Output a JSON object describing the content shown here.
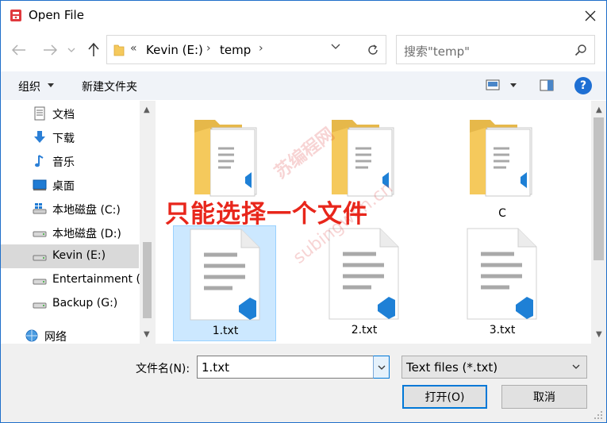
{
  "window": {
    "title": "Open File"
  },
  "address": {
    "overflow": "«",
    "segments": [
      "Kevin (E:)",
      "temp"
    ]
  },
  "search": {
    "placeholder": "搜索\"temp\""
  },
  "toolbar": {
    "organize_label": "组织",
    "new_folder_label": "新建文件夹",
    "help_label": "?"
  },
  "sidebar": {
    "items": [
      {
        "label": "文档",
        "icon": "documents-icon"
      },
      {
        "label": "下载",
        "icon": "downloads-icon"
      },
      {
        "label": "音乐",
        "icon": "music-icon"
      },
      {
        "label": "桌面",
        "icon": "desktop-icon"
      },
      {
        "label": "本地磁盘 (C:)",
        "icon": "windows-drive-icon"
      },
      {
        "label": "本地磁盘 (D:)",
        "icon": "drive-icon"
      },
      {
        "label": "Kevin (E:)",
        "icon": "drive-icon",
        "selected": true
      },
      {
        "label": "Entertainment (",
        "icon": "drive-icon"
      },
      {
        "label": "Backup (G:)",
        "icon": "drive-icon"
      },
      {
        "label": "网络",
        "icon": "network-icon"
      }
    ]
  },
  "files": [
    {
      "label": "",
      "kind": "folder"
    },
    {
      "label": "",
      "kind": "folder"
    },
    {
      "label": "C",
      "kind": "folder"
    },
    {
      "label": "1.txt",
      "kind": "text-file",
      "selected": true
    },
    {
      "label": "2.txt",
      "kind": "text-file"
    },
    {
      "label": "3.txt",
      "kind": "text-file"
    }
  ],
  "annotation": {
    "text": "只能选择一个文件"
  },
  "watermark": {
    "line1": "苏编程网",
    "line2": "subingwen.cn"
  },
  "bottom": {
    "filename_label": "文件名(N):",
    "filename_value": "1.txt",
    "filetype_value": "Text files (*.txt)",
    "open_label": "打开(O)",
    "cancel_label": "取消"
  },
  "colors": {
    "accent": "#0078d7",
    "annotation": "#e8261b",
    "selection": "#cce8ff",
    "folder": "#f5c95c",
    "vscode": "#1e80d6"
  }
}
